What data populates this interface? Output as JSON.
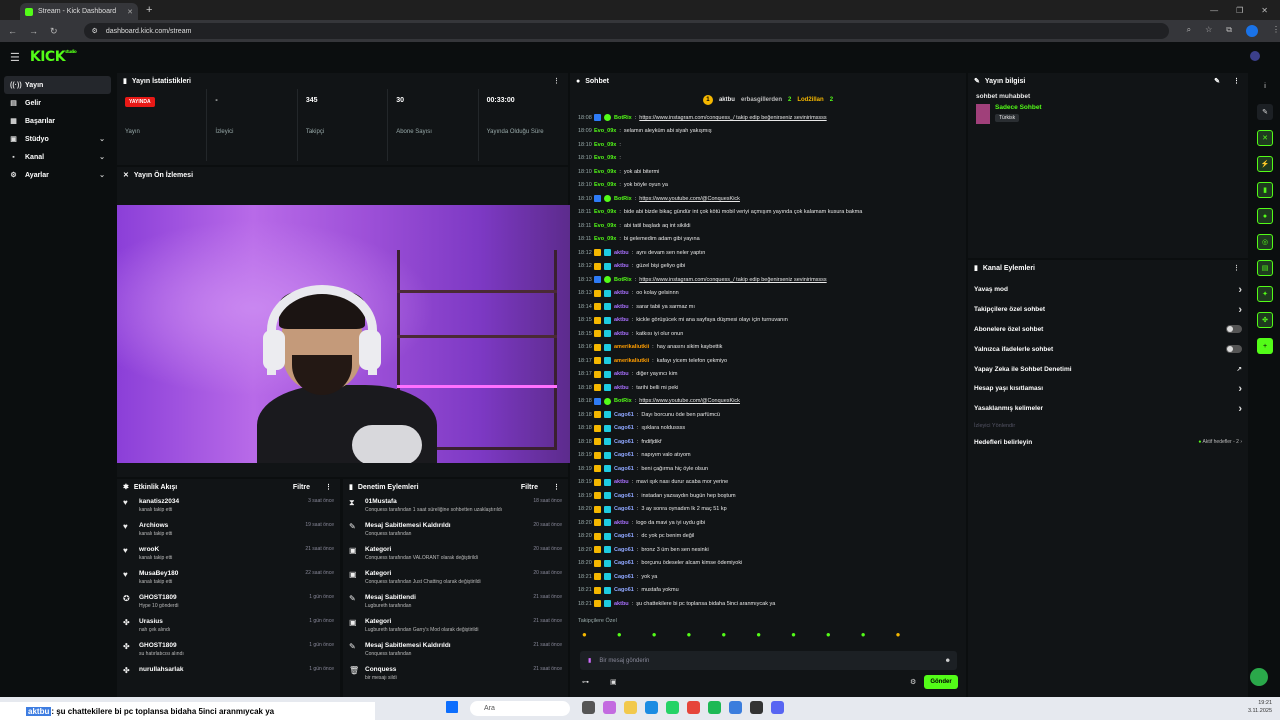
{
  "browser": {
    "tab_title": "Stream - Kick Dashboard",
    "url": "dashboard.kick.com/stream",
    "profile_initial": "K"
  },
  "brand": {
    "logo": "KICK",
    "accent": "#53fc18"
  },
  "sidebar": {
    "items": [
      {
        "label": "Yayın",
        "icon": "broadcast-icon",
        "active": true
      },
      {
        "label": "Gelir",
        "icon": "wallet-icon"
      },
      {
        "label": "Başarılar",
        "icon": "trophy-icon"
      },
      {
        "label": "Stüdyo",
        "icon": "studio-icon",
        "expandable": true
      },
      {
        "label": "Kanal",
        "icon": "channel-icon",
        "expandable": true
      },
      {
        "label": "Ayarlar",
        "icon": "gear-icon",
        "expandable": true
      }
    ]
  },
  "stats": {
    "title": "Yayın İstatistikleri",
    "items": [
      {
        "value": "YAYINDA",
        "label": "Yayın"
      },
      {
        "value": "-",
        "label": "İzleyici"
      },
      {
        "value": "345",
        "label": "Takipçi"
      },
      {
        "value": "30",
        "label": "Abone Sayısı"
      },
      {
        "value": "00:33:00",
        "label": "Yayında Olduğu Süre"
      }
    ]
  },
  "preview": {
    "title": "Yayın Ön İzlemesi"
  },
  "activity": {
    "title": "Etkinlik Akışı",
    "filter": "Filtre",
    "rows": [
      {
        "name": "kanatisz2034",
        "desc": "kanalı takip etti",
        "time": "3 saat önce",
        "icon": "♥"
      },
      {
        "name": "Archiows",
        "desc": "kanalı takip etti",
        "time": "19 saat önce",
        "icon": "♥"
      },
      {
        "name": "wrooK",
        "desc": "kanalı takip etti",
        "time": "21 saat önce",
        "icon": "♥"
      },
      {
        "name": "MusaBey180",
        "desc": "kanalı takip etti",
        "time": "22 saat önce",
        "icon": "♥"
      },
      {
        "name": "GHOST1809",
        "desc": "Hype 10 gönderdi",
        "time": "1 gün önce",
        "icon": "✪"
      },
      {
        "name": "Urasius",
        "desc": "nah çek alındı",
        "time": "1 gün önce",
        "icon": "✤"
      },
      {
        "name": "GHOST1809",
        "desc": "su hatırlatıcısı alındı",
        "time": "1 gün önce",
        "icon": "✤"
      },
      {
        "name": "nurullahsarlak",
        "desc": "",
        "time": "1 gün önce",
        "icon": "✤"
      }
    ]
  },
  "moderation": {
    "title": "Denetim Eylemleri",
    "filter": "Filtre",
    "rows": [
      {
        "name": "01Mustafa",
        "desc": "Conquess tarafından 1 saat süreliğine sohbetten uzaklaştırıldı",
        "time": "18 saat önce",
        "icon": "⧗"
      },
      {
        "name": "Mesaj Sabitlemesi Kaldırıldı",
        "desc": "Conquess tarafından",
        "time": "20 saat önce",
        "icon": "✎"
      },
      {
        "name": "Kategori",
        "desc": "Conquess tarafından VALORANT olarak değiştirildi",
        "time": "20 saat önce",
        "icon": "▣"
      },
      {
        "name": "Kategori",
        "desc": "Conquess tarafından Just Chatting olarak değiştirildi",
        "time": "20 saat önce",
        "icon": "▣"
      },
      {
        "name": "Mesaj Sabitlendi",
        "desc": "Lugbureth tarafından",
        "time": "21 saat önce",
        "icon": "✎"
      },
      {
        "name": "Kategori",
        "desc": "Lugbureth tarafından Garry's Mod olarak değiştirildi",
        "time": "21 saat önce",
        "icon": "▣"
      },
      {
        "name": "Mesaj Sabitlemesi Kaldırıldı",
        "desc": "Conquess tarafından",
        "time": "21 saat önce",
        "icon": "✎"
      },
      {
        "name": "Conquess",
        "desc": "bir mesajı sildi",
        "time": "21 saat önce",
        "icon": "🗑"
      }
    ]
  },
  "chat": {
    "title": "Sohbet",
    "top": [
      {
        "name": "aktbu",
        "value": "1"
      },
      {
        "name": "erbasgillerden",
        "value": "2"
      },
      {
        "name": "Lod2illan",
        "value": "2"
      }
    ],
    "messages": [
      {
        "t": "18:08",
        "u": "BotRix",
        "c": "#53fc18",
        "m": "https://www.instagram.com/conquess_/ takip edip beğenirseniz sevinirimssss"
      },
      {
        "t": "18:09",
        "u": "Evo_09x",
        "c": "#53fc18",
        "m": "selamın aleyküm abi siyah yakışmış"
      },
      {
        "t": "18:10",
        "u": "Evo_09x",
        "c": "#53fc18",
        "m": ""
      },
      {
        "t": "18:10",
        "u": "Evo_09x",
        "c": "#53fc18",
        "m": ""
      },
      {
        "t": "18:10",
        "u": "Evo_09x",
        "c": "#53fc18",
        "m": "yok abi bitermi"
      },
      {
        "t": "18:10",
        "u": "Evo_09x",
        "c": "#53fc18",
        "m": "yok böyle oyun ya"
      },
      {
        "t": "18:10",
        "u": "BotRix",
        "c": "#53fc18",
        "m": "https://www.youtube.com/@ConquesKick"
      },
      {
        "t": "18:11",
        "u": "Evo_09x",
        "c": "#53fc18",
        "m": "bide abi bizde bikaç gündür int çok kötü mobil veriyi açmışım yayında çok kalamam kusura bakma"
      },
      {
        "t": "18:11",
        "u": "Evo_09x",
        "c": "#53fc18",
        "m": "abi tatil başladı aq int sikildi"
      },
      {
        "t": "18:11",
        "u": "Evo_09x",
        "c": "#53fc18",
        "m": "bi gelemedim adam gibi yayına"
      },
      {
        "t": "18:12",
        "u": "aktbu",
        "c": "#a970ff",
        "m": "aynı devam sen neler yaptın"
      },
      {
        "t": "18:12",
        "u": "aktbu",
        "c": "#a970ff",
        "m": "güzel bişi geliyo gibi"
      },
      {
        "t": "18:13",
        "u": "BotRix",
        "c": "#53fc18",
        "m": "https://www.instagram.com/conquess_/ takip edip beğenirseniz sevinirimssss"
      },
      {
        "t": "18:13",
        "u": "aktbu",
        "c": "#a970ff",
        "m": "oo kolay gelsinnn"
      },
      {
        "t": "18:14",
        "u": "aktbu",
        "c": "#a970ff",
        "m": "sarar tabii ya sarmaz mı"
      },
      {
        "t": "18:15",
        "u": "aktbu",
        "c": "#a970ff",
        "m": "kickle görüşücek mi ana sayfaya düşmesi olayı için turnuvanın"
      },
      {
        "t": "18:15",
        "u": "aktbu",
        "c": "#a970ff",
        "m": "katkısı iyi olur onun"
      },
      {
        "t": "18:16",
        "u": "amerikaliutkii",
        "c": "#ff9d00",
        "m": "hay anasını sikim kaybettik"
      },
      {
        "t": "18:17",
        "u": "amerikaliutkii",
        "c": "#ff9d00",
        "m": "kafayı yicem telefon çekmiyo"
      },
      {
        "t": "18:17",
        "u": "aktbu",
        "c": "#a970ff",
        "m": "diğer yayıncı kim"
      },
      {
        "t": "18:18",
        "u": "aktbu",
        "c": "#a970ff",
        "m": "tarihi belli mi peki"
      },
      {
        "t": "18:18",
        "u": "BotRix",
        "c": "#53fc18",
        "m": "https://www.youtube.com/@ConquesKick"
      },
      {
        "t": "18:18",
        "u": "Cago61",
        "c": "#8fa7ff",
        "m": "Dayı borcunu öde ben parfümcü"
      },
      {
        "t": "18:18",
        "u": "Cago61",
        "c": "#8fa7ff",
        "m": "ışıklara noldussss"
      },
      {
        "t": "18:18",
        "u": "Cago61",
        "c": "#8fa7ff",
        "m": "fndifjdikf"
      },
      {
        "t": "18:19",
        "u": "Cago61",
        "c": "#8fa7ff",
        "m": "napıyım valo atıyom"
      },
      {
        "t": "18:19",
        "u": "Cago61",
        "c": "#8fa7ff",
        "m": "beni çağırma hiç öyle olsun"
      },
      {
        "t": "18:19",
        "u": "aktbu",
        "c": "#a970ff",
        "m": "mavi ışık nası durur acaba mor yerine"
      },
      {
        "t": "18:19",
        "u": "Cago61",
        "c": "#8fa7ff",
        "m": "instadan yazsaydın bugün hep boştum"
      },
      {
        "t": "18:20",
        "u": "Cago61",
        "c": "#8fa7ff",
        "m": "3 ay sonra oynadım lk 2 maç 51 kp"
      },
      {
        "t": "18:20",
        "u": "aktbu",
        "c": "#a970ff",
        "m": "logo da mavi ya iyi uydu gibi"
      },
      {
        "t": "18:20",
        "u": "Cago61",
        "c": "#8fa7ff",
        "m": "dc yok pc benim değil"
      },
      {
        "t": "18:20",
        "u": "Cago61",
        "c": "#8fa7ff",
        "m": "bronz 3 üm ben sen nesinki"
      },
      {
        "t": "18:20",
        "u": "Cago61",
        "c": "#8fa7ff",
        "m": "borçunu ödeseler alcam kimse ödemiyoki"
      },
      {
        "t": "18:21",
        "u": "Cago61",
        "c": "#8fa7ff",
        "m": "yok ya"
      },
      {
        "t": "18:21",
        "u": "Cago61",
        "c": "#8fa7ff",
        "m": "mustafa yokmu"
      },
      {
        "t": "18:21",
        "u": "aktbu",
        "c": "#a970ff",
        "m": "şu chattekilere bi pc toplansa bidaha 5inci aranmıycak ya"
      }
    ],
    "mode": "Takipçilere Özel",
    "placeholder": "Bir mesaj gönderin",
    "send": "Gönder"
  },
  "streaminfo": {
    "title": "Yayın bilgisi",
    "stream_title": "sohbet muhabbet",
    "category": "Sadece Sohbet",
    "language": "Türkisk"
  },
  "channel_actions": {
    "title": "Kanal Eylemleri",
    "items": [
      {
        "label": "Yavaş mod",
        "ctl": "chevron"
      },
      {
        "label": "Takipçilere özel sohbet",
        "ctl": "chevron"
      },
      {
        "label": "Abonelere özel sohbet",
        "ctl": "toggle"
      },
      {
        "label": "Yalnızca ifadelerle sohbet",
        "ctl": "toggle"
      },
      {
        "label": "Yapay Zeka ile Sohbet Denetimi",
        "ctl": "external"
      },
      {
        "label": "Hesap yaşı kısıtlaması",
        "ctl": "chevron"
      },
      {
        "label": "Yasaklanmış kelimeler",
        "ctl": "chevron"
      }
    ],
    "section": "İzleyici Yönlendir",
    "goals": {
      "label": "Hedefleri belirleyin",
      "status": "Aktif hedefler - 2"
    }
  },
  "ticker": {
    "user": "aktbu",
    "text": ": şu chattekilere bi pc toplansa bidaha 5inci aranmıycak ya"
  },
  "taskbar": {
    "search": "Ara",
    "time": "19:21",
    "date": "3.11.2025"
  }
}
